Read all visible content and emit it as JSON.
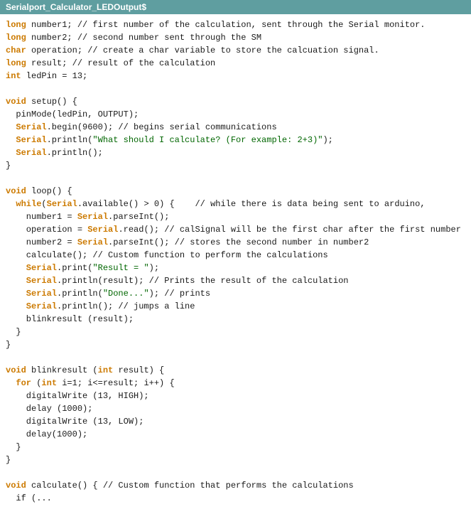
{
  "titleBar": {
    "label": "Serialport_Calculator_LEDOutput$"
  },
  "code": {
    "lines": [
      {
        "indent": 0,
        "parts": [
          {
            "type": "kw",
            "text": "long"
          },
          {
            "type": "normal",
            "text": " number1; // first number of the calculation, sent through the Serial monitor."
          }
        ]
      },
      {
        "indent": 0,
        "parts": [
          {
            "type": "kw",
            "text": "long"
          },
          {
            "type": "normal",
            "text": " number2; // second number sent through the SM"
          }
        ]
      },
      {
        "indent": 0,
        "parts": [
          {
            "type": "kw",
            "text": "char"
          },
          {
            "type": "normal",
            "text": " operation; // create a char variable to store the calcuation signal."
          }
        ]
      },
      {
        "indent": 0,
        "parts": [
          {
            "type": "kw",
            "text": "long"
          },
          {
            "type": "normal",
            "text": " result; // result of the calculation"
          }
        ]
      },
      {
        "indent": 0,
        "parts": [
          {
            "type": "kw",
            "text": "int"
          },
          {
            "type": "normal",
            "text": " ledPin = 13;"
          }
        ]
      },
      {
        "indent": 0,
        "parts": [
          {
            "type": "normal",
            "text": ""
          }
        ]
      },
      {
        "indent": 0,
        "parts": [
          {
            "type": "kw",
            "text": "void"
          },
          {
            "type": "normal",
            "text": " setup() {"
          }
        ]
      },
      {
        "indent": 2,
        "parts": [
          {
            "type": "normal",
            "text": "  pinMode(ledPin, OUTPUT);"
          }
        ]
      },
      {
        "indent": 2,
        "parts": [
          {
            "type": "obj",
            "text": "  Serial"
          },
          {
            "type": "normal",
            "text": ".begin(9600); // begins serial communications"
          }
        ]
      },
      {
        "indent": 2,
        "parts": [
          {
            "type": "obj",
            "text": "  Serial"
          },
          {
            "type": "normal",
            "text": ".println("
          },
          {
            "type": "str",
            "text": "\"What should I calculate? (For example: 2+3)\""
          },
          {
            "type": "normal",
            "text": ");"
          }
        ]
      },
      {
        "indent": 2,
        "parts": [
          {
            "type": "obj",
            "text": "  Serial"
          },
          {
            "type": "normal",
            "text": ".println();"
          }
        ]
      },
      {
        "indent": 0,
        "parts": [
          {
            "type": "normal",
            "text": "}"
          }
        ]
      },
      {
        "indent": 0,
        "parts": [
          {
            "type": "normal",
            "text": ""
          }
        ]
      },
      {
        "indent": 0,
        "parts": [
          {
            "type": "kw",
            "text": "void"
          },
          {
            "type": "normal",
            "text": " loop() {"
          }
        ]
      },
      {
        "indent": 2,
        "parts": [
          {
            "type": "kw",
            "text": "  while"
          },
          {
            "type": "normal",
            "text": "("
          },
          {
            "type": "obj",
            "text": "Serial"
          },
          {
            "type": "normal",
            "text": ".available() > 0) {    // while there is data being sent to arduino,"
          }
        ]
      },
      {
        "indent": 4,
        "parts": [
          {
            "type": "normal",
            "text": "    number1 = "
          },
          {
            "type": "obj",
            "text": "Serial"
          },
          {
            "type": "normal",
            "text": ".parseInt();"
          }
        ]
      },
      {
        "indent": 4,
        "parts": [
          {
            "type": "normal",
            "text": "    operation = "
          },
          {
            "type": "obj",
            "text": "Serial"
          },
          {
            "type": "normal",
            "text": ".read(); // calSignal will be the first char after the first number"
          }
        ]
      },
      {
        "indent": 4,
        "parts": [
          {
            "type": "normal",
            "text": "    number2 = "
          },
          {
            "type": "obj",
            "text": "Serial"
          },
          {
            "type": "normal",
            "text": ".parseInt(); // stores the second number in number2"
          }
        ]
      },
      {
        "indent": 4,
        "parts": [
          {
            "type": "normal",
            "text": "    calculate(); // Custom function to perform the calculations"
          }
        ]
      },
      {
        "indent": 4,
        "parts": [
          {
            "type": "obj",
            "text": "    Serial"
          },
          {
            "type": "normal",
            "text": ".print("
          },
          {
            "type": "str",
            "text": "\"Result = \""
          },
          {
            "type": "normal",
            "text": ");"
          }
        ]
      },
      {
        "indent": 4,
        "parts": [
          {
            "type": "obj",
            "text": "    Serial"
          },
          {
            "type": "normal",
            "text": ".println(result); // Prints the result of the calculation"
          }
        ]
      },
      {
        "indent": 4,
        "parts": [
          {
            "type": "obj",
            "text": "    Serial"
          },
          {
            "type": "normal",
            "text": ".println("
          },
          {
            "type": "str",
            "text": "\"Done...\""
          },
          {
            "type": "normal",
            "text": "); // prints"
          }
        ]
      },
      {
        "indent": 4,
        "parts": [
          {
            "type": "obj",
            "text": "    Serial"
          },
          {
            "type": "normal",
            "text": ".println(); // jumps a line"
          }
        ]
      },
      {
        "indent": 4,
        "parts": [
          {
            "type": "normal",
            "text": "    blinkresult (result);"
          }
        ]
      },
      {
        "indent": 2,
        "parts": [
          {
            "type": "normal",
            "text": "  }"
          }
        ]
      },
      {
        "indent": 0,
        "parts": [
          {
            "type": "normal",
            "text": "}"
          }
        ]
      },
      {
        "indent": 0,
        "parts": [
          {
            "type": "normal",
            "text": ""
          }
        ]
      },
      {
        "indent": 0,
        "parts": [
          {
            "type": "kw",
            "text": "void"
          },
          {
            "type": "normal",
            "text": " blinkresult ("
          },
          {
            "type": "kw",
            "text": "int"
          },
          {
            "type": "normal",
            "text": " result) {"
          }
        ]
      },
      {
        "indent": 2,
        "parts": [
          {
            "type": "kw",
            "text": "  for"
          },
          {
            "type": "normal",
            "text": " ("
          },
          {
            "type": "kw",
            "text": "int"
          },
          {
            "type": "normal",
            "text": " i=1; i<=result; i++) {"
          }
        ]
      },
      {
        "indent": 4,
        "parts": [
          {
            "type": "normal",
            "text": "    digitalWrite (13, HIGH);"
          }
        ]
      },
      {
        "indent": 4,
        "parts": [
          {
            "type": "normal",
            "text": "    delay (1000);"
          }
        ]
      },
      {
        "indent": 4,
        "parts": [
          {
            "type": "normal",
            "text": "    digitalWrite (13, LOW);"
          }
        ]
      },
      {
        "indent": 4,
        "parts": [
          {
            "type": "normal",
            "text": "    delay(1000);"
          }
        ]
      },
      {
        "indent": 2,
        "parts": [
          {
            "type": "normal",
            "text": "  }"
          }
        ]
      },
      {
        "indent": 0,
        "parts": [
          {
            "type": "normal",
            "text": "}"
          }
        ]
      },
      {
        "indent": 0,
        "parts": [
          {
            "type": "normal",
            "text": ""
          }
        ]
      },
      {
        "indent": 0,
        "parts": [
          {
            "type": "kw",
            "text": "void"
          },
          {
            "type": "normal",
            "text": " calculate() { // Custom function that performs the calculations"
          }
        ]
      },
      {
        "indent": 2,
        "parts": [
          {
            "type": "normal",
            "text": "  if (..."
          }
        ]
      }
    ]
  }
}
